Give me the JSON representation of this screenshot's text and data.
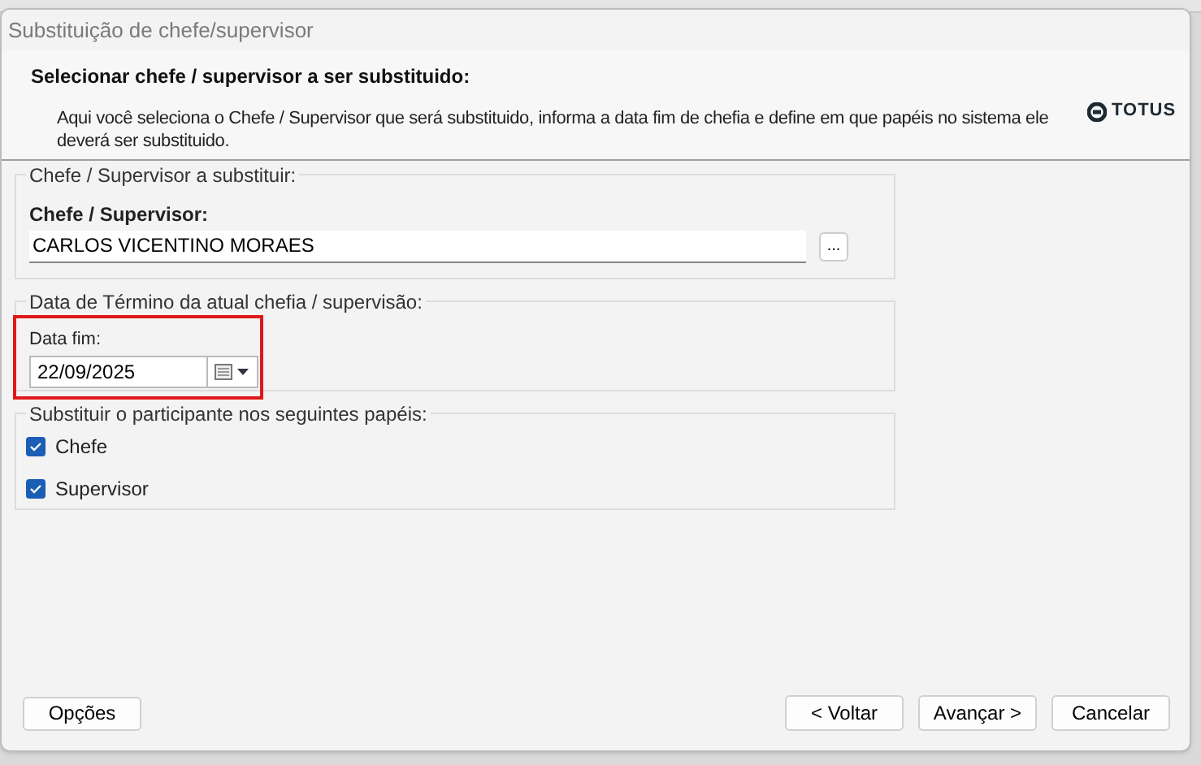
{
  "window": {
    "title": "Substituição de chefe/supervisor"
  },
  "header": {
    "title": "Selecionar chefe / supervisor a ser substituido:",
    "description": "Aqui você seleciona o Chefe / Supervisor que será substituido, informa a data fim de chefia e define em que papéis no sistema ele deverá ser substituido.",
    "logo": "TOTUS"
  },
  "supervisor_group": {
    "legend": "Chefe / Supervisor a substituir:",
    "label": "Chefe / Supervisor:",
    "value": "CARLOS VICENTINO MORAES",
    "browse_button": "..."
  },
  "date_group": {
    "legend": "Data de Término da atual chefia / supervisão:",
    "label": "Data fim:",
    "value": "22/09/2025",
    "highlighted": true
  },
  "roles_group": {
    "legend": "Substituir o participante nos seguintes papéis:",
    "roles": [
      {
        "label": "Chefe",
        "checked": true
      },
      {
        "label": "Supervisor",
        "checked": true
      }
    ]
  },
  "footer": {
    "options_button": "Opções",
    "buttons": [
      "< Voltar",
      "Avançar >",
      "Cancelar"
    ]
  }
}
